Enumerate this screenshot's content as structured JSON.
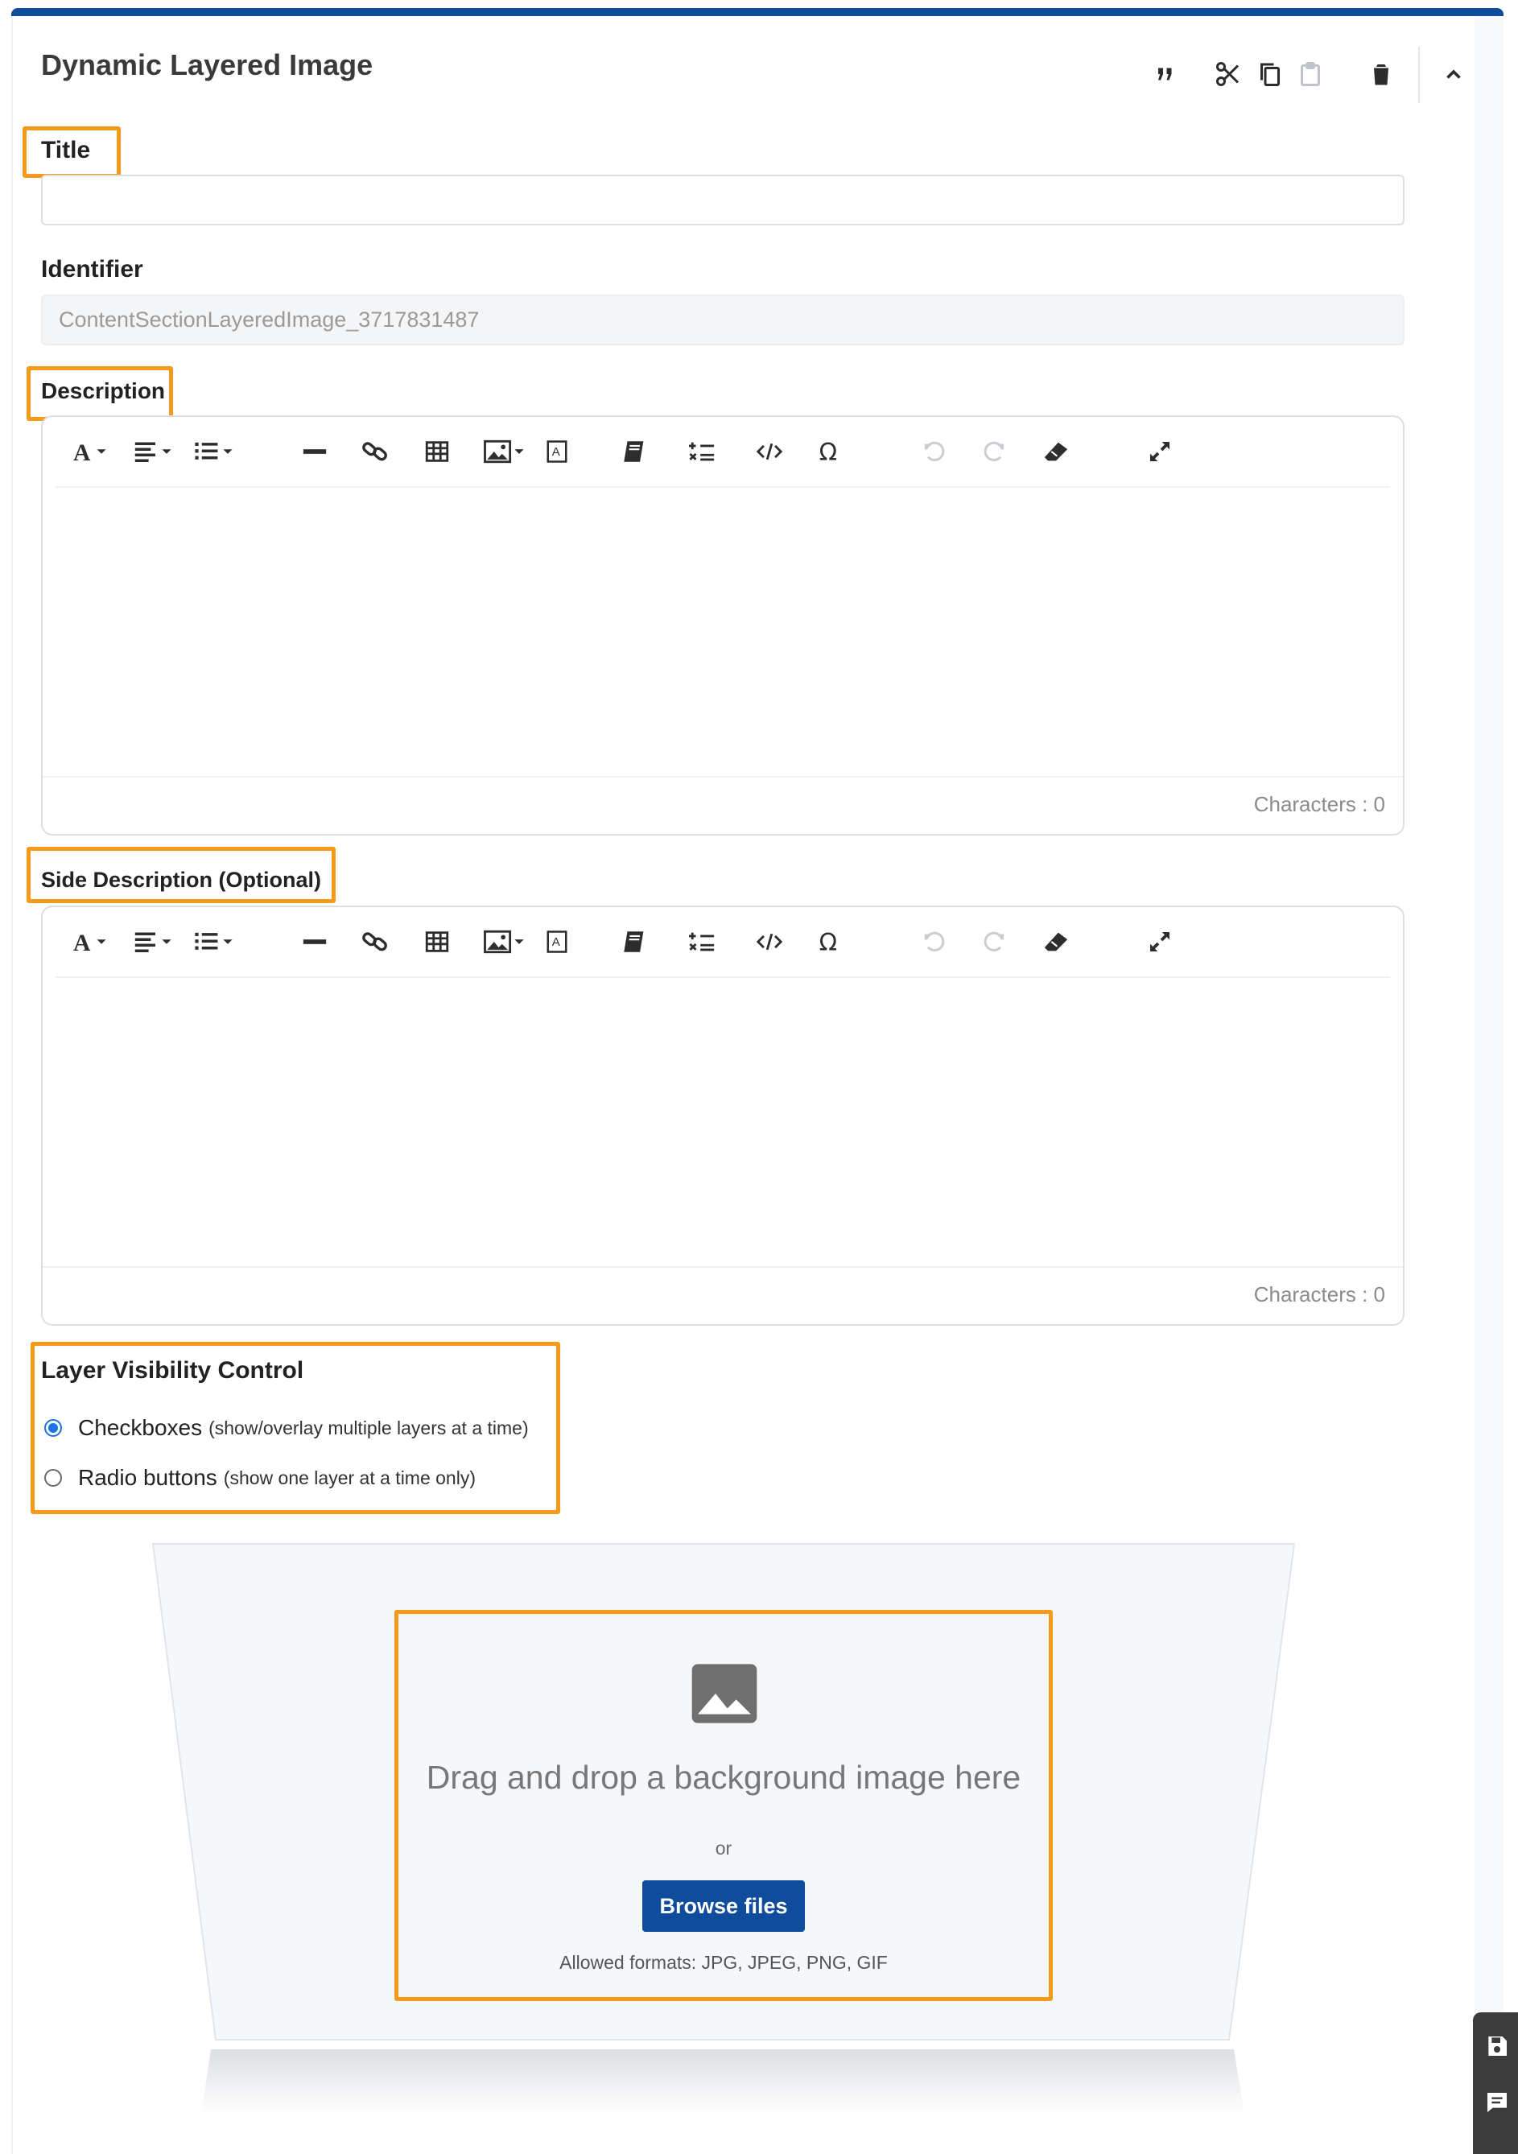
{
  "panel": {
    "heading": "Dynamic Layered Image",
    "accent_color": "#0f4c9b",
    "highlight_color": "#f59a1b"
  },
  "header_toolbar": [
    "quote-icon",
    "cut-icon",
    "copy-icon",
    "paste-icon",
    "delete-icon",
    "chevron-up-icon"
  ],
  "fields": {
    "title": {
      "label": "Title",
      "value": ""
    },
    "identifier": {
      "label": "Identifier",
      "value": "ContentSectionLayeredImage_3717831487"
    },
    "description": {
      "label": "Description",
      "characters_label": "Characters : 0"
    },
    "side_description": {
      "label": "Side Description (Optional)",
      "characters_label": "Characters : 0"
    }
  },
  "editor_toolbar": [
    "font-icon",
    "align-icon",
    "list-icon",
    "horizontal-rule-icon",
    "link-icon",
    "table-icon",
    "image-icon",
    "textbox-icon",
    "book-icon",
    "formula-icon",
    "code-icon",
    "omega-icon",
    "undo-icon",
    "redo-icon",
    "eraser-icon",
    "expand-icon"
  ],
  "layer_visibility": {
    "label": "Layer Visibility Control",
    "options": [
      {
        "label": "Checkboxes",
        "hint": "(show/overlay multiple layers at a time)",
        "checked": true
      },
      {
        "label": "Radio buttons",
        "hint": "(show one layer at a time only)",
        "checked": false
      }
    ]
  },
  "dropzone": {
    "title": "Drag and drop a background image here",
    "or": "or",
    "button": "Browse files",
    "formats": "Allowed formats: JPG, JPEG, PNG, GIF",
    "icon": "image-icon"
  },
  "side_dock": [
    "save-icon",
    "comment-icon"
  ]
}
